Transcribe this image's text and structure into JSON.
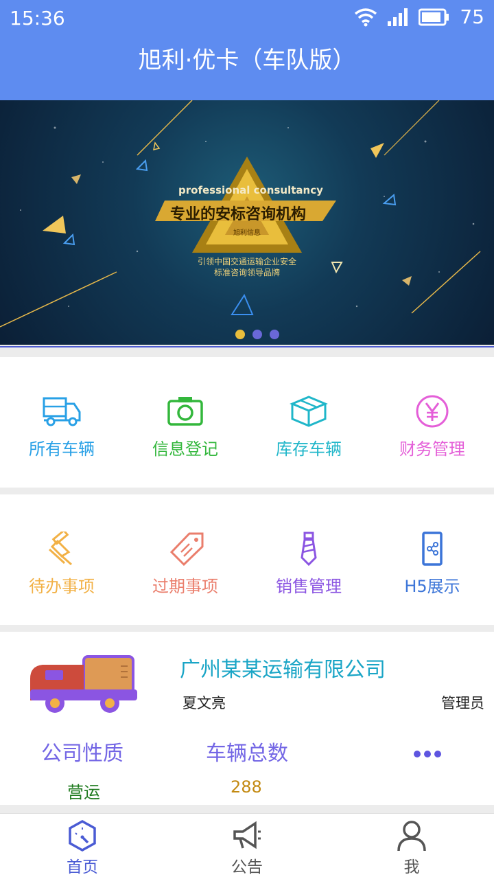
{
  "status": {
    "time": "15:36",
    "battery": "75"
  },
  "header": {
    "title": "旭利·优卡（车队版）"
  },
  "banner": {
    "en_text": "professional consultancy",
    "cn_title": "专业的安标咨询机构",
    "slogan_line1": "引领中国交通运输企业安全",
    "slogan_line2": "标准咨询领导品牌",
    "logo_text": "旭利信息"
  },
  "grid1": [
    {
      "label": "所有车辆",
      "color": "#28a0e6",
      "icon": "truck-icon"
    },
    {
      "label": "信息登记",
      "color": "#33b73c",
      "icon": "camera-icon"
    },
    {
      "label": "库存车辆",
      "color": "#1fb6c9",
      "icon": "box-icon"
    },
    {
      "label": "财务管理",
      "color": "#e45fd8",
      "icon": "yen-icon"
    }
  ],
  "grid2": [
    {
      "label": "待办事项",
      "color": "#f2b146",
      "icon": "pin-icon"
    },
    {
      "label": "过期事项",
      "color": "#ea7e6c",
      "icon": "tag-icon"
    },
    {
      "label": "销售管理",
      "color": "#8b55e2",
      "icon": "tie-icon"
    },
    {
      "label": "H5展示",
      "color": "#3c75d8",
      "icon": "share-phone-icon"
    }
  ],
  "company": {
    "name": "广州某某运输有限公司",
    "person": "夏文亮",
    "role": "管理员",
    "nature_label": "公司性质",
    "nature_value": "营运",
    "count_label": "车辆总数",
    "count_value": "288"
  },
  "tabs": [
    {
      "label": "首页",
      "color": "#4a5bd4",
      "icon": "dashboard-icon"
    },
    {
      "label": "公告",
      "color": "#555555",
      "icon": "megaphone-icon"
    },
    {
      "label": "我",
      "color": "#555555",
      "icon": "user-icon"
    }
  ]
}
